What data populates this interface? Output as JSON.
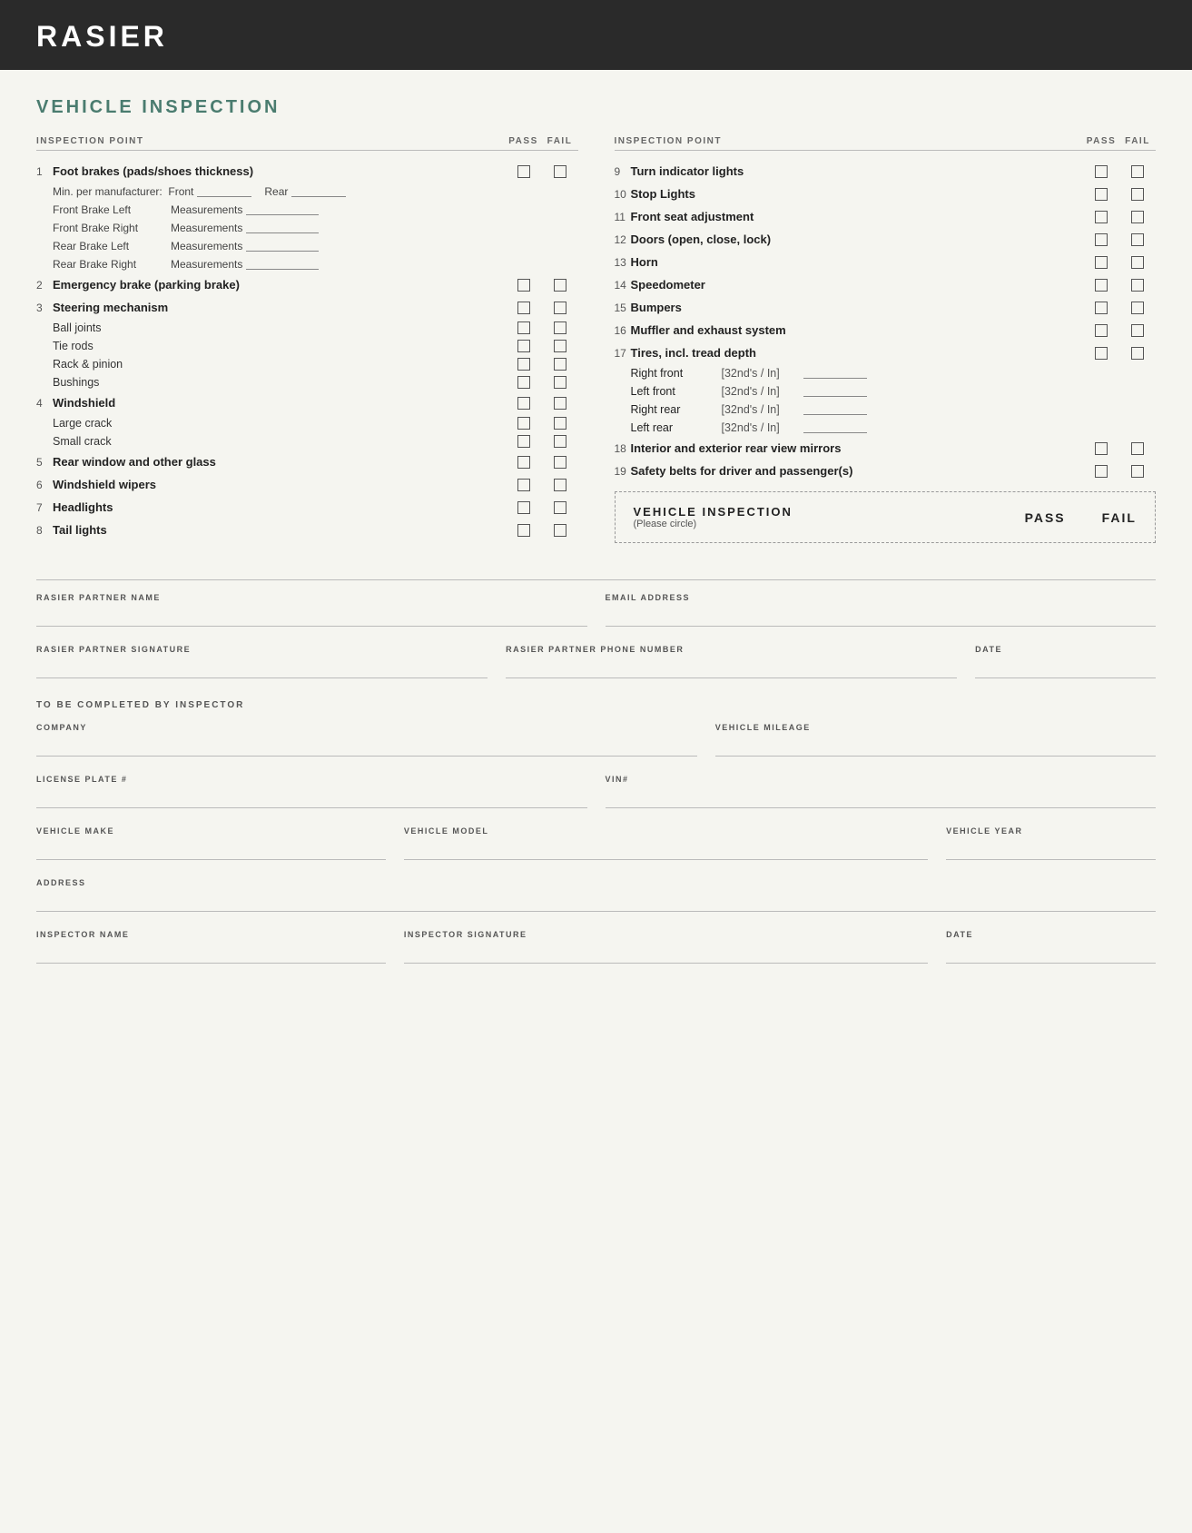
{
  "header": {
    "title": "RASIER"
  },
  "page": {
    "section_title": "VEHICLE INSPECTION"
  },
  "left_column": {
    "header": {
      "inspection_point": "INSPECTION POINT",
      "pass": "PASS",
      "fail": "FAIL"
    },
    "items": [
      {
        "number": "1",
        "label": "Foot brakes (pads/shoes thickness)",
        "bold": true,
        "has_checkbox": true,
        "sub_items": [
          {
            "type": "min_per",
            "label": "Min. per manufacturer:",
            "front_label": "Front",
            "rear_label": "Rear"
          },
          {
            "type": "measurement",
            "label": "Front Brake Left",
            "meas_label": "Measurements"
          },
          {
            "type": "measurement",
            "label": "Front Brake Right",
            "meas_label": "Measurements"
          },
          {
            "type": "measurement",
            "label": "Rear Brake Left",
            "meas_label": "Measurements"
          },
          {
            "type": "measurement",
            "label": "Rear Brake Right",
            "meas_label": "Measurements"
          }
        ]
      },
      {
        "number": "2",
        "label": "Emergency brake (parking brake)",
        "bold": true,
        "has_checkbox": true
      },
      {
        "number": "3",
        "label": "Steering mechanism",
        "bold": true,
        "has_checkbox": true,
        "sub_items": [
          {
            "type": "check",
            "label": "Ball joints"
          },
          {
            "type": "check",
            "label": "Tie rods"
          },
          {
            "type": "check",
            "label": "Rack & pinion"
          },
          {
            "type": "check",
            "label": "Bushings"
          }
        ]
      },
      {
        "number": "4",
        "label": "Windshield",
        "bold": true,
        "has_checkbox": true,
        "sub_items": [
          {
            "type": "check",
            "label": "Large crack"
          },
          {
            "type": "check",
            "label": "Small crack"
          }
        ]
      },
      {
        "number": "5",
        "label": "Rear window and other glass",
        "bold": true,
        "has_checkbox": true
      },
      {
        "number": "6",
        "label": "Windshield wipers",
        "bold": true,
        "has_checkbox": true
      },
      {
        "number": "7",
        "label": "Headlights",
        "bold": true,
        "has_checkbox": true
      },
      {
        "number": "8",
        "label": "Tail lights",
        "bold": true,
        "has_checkbox": true
      }
    ]
  },
  "right_column": {
    "header": {
      "inspection_point": "INSPECTION POINT",
      "pass": "PASS",
      "fail": "FAIL"
    },
    "items": [
      {
        "number": "9",
        "label": "Turn indicator lights",
        "bold": true,
        "has_checkbox": true
      },
      {
        "number": "10",
        "label": "Stop Lights",
        "bold": true,
        "has_checkbox": true
      },
      {
        "number": "11",
        "label": "Front seat adjustment",
        "bold": true,
        "has_checkbox": true
      },
      {
        "number": "12",
        "label": "Doors (open, close, lock)",
        "bold": true,
        "has_checkbox": true
      },
      {
        "number": "13",
        "label": "Horn",
        "bold": true,
        "has_checkbox": true
      },
      {
        "number": "14",
        "label": "Speedometer",
        "bold": true,
        "has_checkbox": true
      },
      {
        "number": "15",
        "label": "Bumpers",
        "bold": true,
        "has_checkbox": true
      },
      {
        "number": "16",
        "label": "Muffler and exhaust system",
        "bold": true,
        "has_checkbox": true
      },
      {
        "number": "17",
        "label": "Tires, incl. tread depth",
        "bold": true,
        "has_checkbox": true,
        "tire_items": [
          {
            "position": "Right front",
            "measure": "[32nd's / In]"
          },
          {
            "position": "Left front",
            "measure": "[32nd's / In]"
          },
          {
            "position": "Right rear",
            "measure": "[32nd's / In]"
          },
          {
            "position": "Left rear",
            "measure": "[32nd's / In]"
          }
        ]
      },
      {
        "number": "18",
        "label": "Interior and exterior rear view mirrors",
        "bold": true,
        "has_checkbox": true
      },
      {
        "number": "19",
        "label": "Safety belts for driver and passenger(s)",
        "bold": true,
        "has_checkbox": true
      }
    ],
    "summary": {
      "title": "VEHICLE INSPECTION",
      "subtitle": "(Please circle)",
      "pass_label": "PASS",
      "fail_label": "FAIL"
    }
  },
  "form": {
    "partner_section": {
      "fields": [
        {
          "id": "partner-name",
          "label": "RASIER PARTNER NAME",
          "value": ""
        },
        {
          "id": "email",
          "label": "EMAIL ADDRESS",
          "value": ""
        },
        {
          "id": "partner-signature",
          "label": "RASIER PARTNER SIGNATURE",
          "value": ""
        },
        {
          "id": "partner-phone",
          "label": "RASIER PARTNER PHONE NUMBER",
          "value": ""
        },
        {
          "id": "date1",
          "label": "DATE",
          "value": ""
        }
      ]
    },
    "inspector_section": {
      "title": "TO BE COMPLETED BY INSPECTOR",
      "fields": [
        {
          "id": "company",
          "label": "COMPANY",
          "value": ""
        },
        {
          "id": "mileage",
          "label": "VEHICLE MILEAGE",
          "value": ""
        },
        {
          "id": "license-plate",
          "label": "LICENSE PLATE #",
          "value": ""
        },
        {
          "id": "vin",
          "label": "VIN#",
          "value": ""
        },
        {
          "id": "vehicle-make",
          "label": "VEHICLE MAKE",
          "value": ""
        },
        {
          "id": "vehicle-model",
          "label": "VEHICLE MODEL",
          "value": ""
        },
        {
          "id": "vehicle-year",
          "label": "VEHICLE YEAR",
          "value": ""
        },
        {
          "id": "address",
          "label": "ADDRESS",
          "value": ""
        },
        {
          "id": "inspector-name",
          "label": "INSPECTOR NAME",
          "value": ""
        },
        {
          "id": "inspector-signature",
          "label": "INSPECTOR SIGNATURE",
          "value": ""
        },
        {
          "id": "date2",
          "label": "DATE",
          "value": ""
        }
      ]
    }
  }
}
